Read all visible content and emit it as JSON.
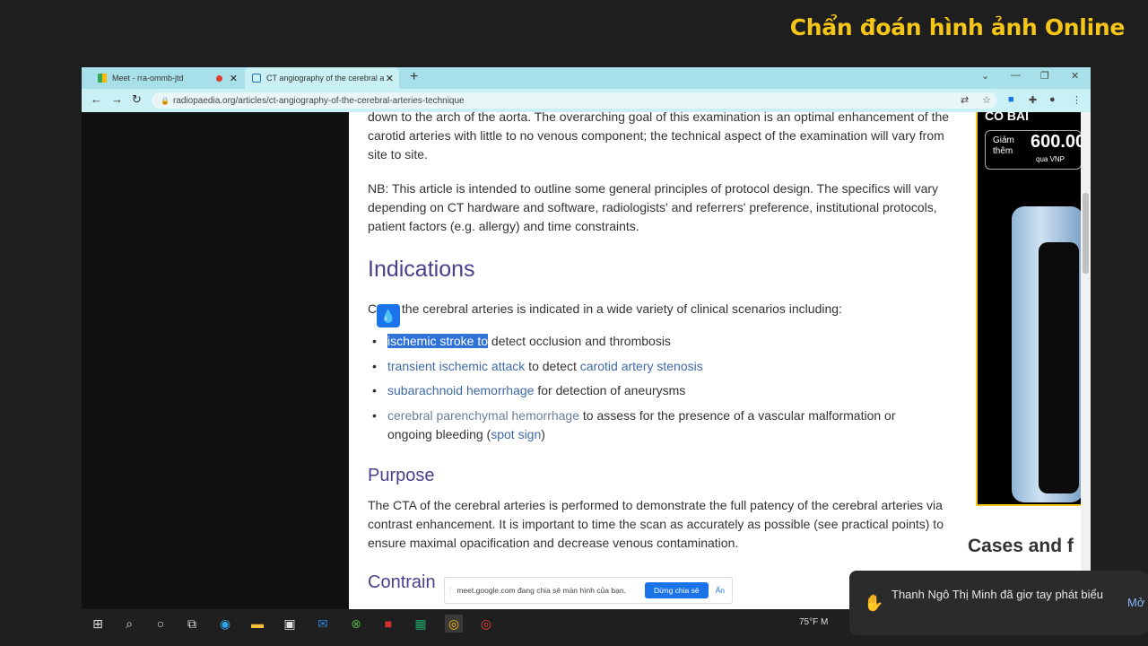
{
  "watermark": "Chẩn đoán hình ảnh Online",
  "browser": {
    "tabs": [
      {
        "title": "Meet - rra-ommb-jtd",
        "active": false
      },
      {
        "title": "CT angiography of the cerebral a",
        "active": true
      }
    ],
    "url": "radiopaedia.org/articles/ct-angiography-of-the-cerebral-arteries-technique"
  },
  "article": {
    "p1": "down to the arch of the aorta. The overarching goal of this examination is an optimal enhancement of the carotid arteries with little to no venous component; the technical aspect of the examination will vary from site to site.",
    "p2": "NB: This article is intended to outline some general principles of protocol design. The specifics will vary depending on CT hardware and software, radiologists' and referrers' preference, institutional protocols, patient factors (e.g. allergy) and time constraints.",
    "indications_heading": "Indications",
    "intro_a": "C",
    "intro_b": "f the cerebral arteries is indicated in a wide variety of clinical scenarios including:",
    "bullets": [
      {
        "link": "ischemic stroke to",
        "rest": " detect occlusion and thrombosis"
      },
      {
        "link": "transient ischemic attack",
        "mid": " to detect ",
        "link2": "carotid artery stenosis"
      },
      {
        "link": "subarachnoid hemorrhage",
        "rest": " for detection of aneurysms"
      },
      {
        "link": "cerebral parenchymal hemorrhage",
        "rest": " to assess for the presence of a vascular malformation or ongoing bleeding (",
        "link2": "spot sign",
        "tail": ")"
      }
    ],
    "purpose_heading": "Purpose",
    "p3": "The CTA of the cerebral arteries is performed to demonstrate the full patency of the cerebral arteries via contrast enhancement.  It is important to time the scan as accurately as possible (see practical points) to ensure maximal opacification and decrease venous contamination.",
    "contra_heading": "Contrain"
  },
  "ad": {
    "top": "CO BAI",
    "label": "Giảm thêm",
    "value": "600.00",
    "sub": "qua VNP"
  },
  "sidebar": {
    "cases_heading": "Cases and f"
  },
  "sharebar": {
    "text": "meet.google.com đang chia sẻ màn hình của bạn.",
    "stop": "Dừng chia sẻ",
    "hide": "Ẩn"
  },
  "taskbar": {
    "weather": "75°F  M"
  },
  "notification": {
    "message": "Thanh Ngô Thị Minh đã giơ tay phát biểu",
    "action": "Mở"
  }
}
